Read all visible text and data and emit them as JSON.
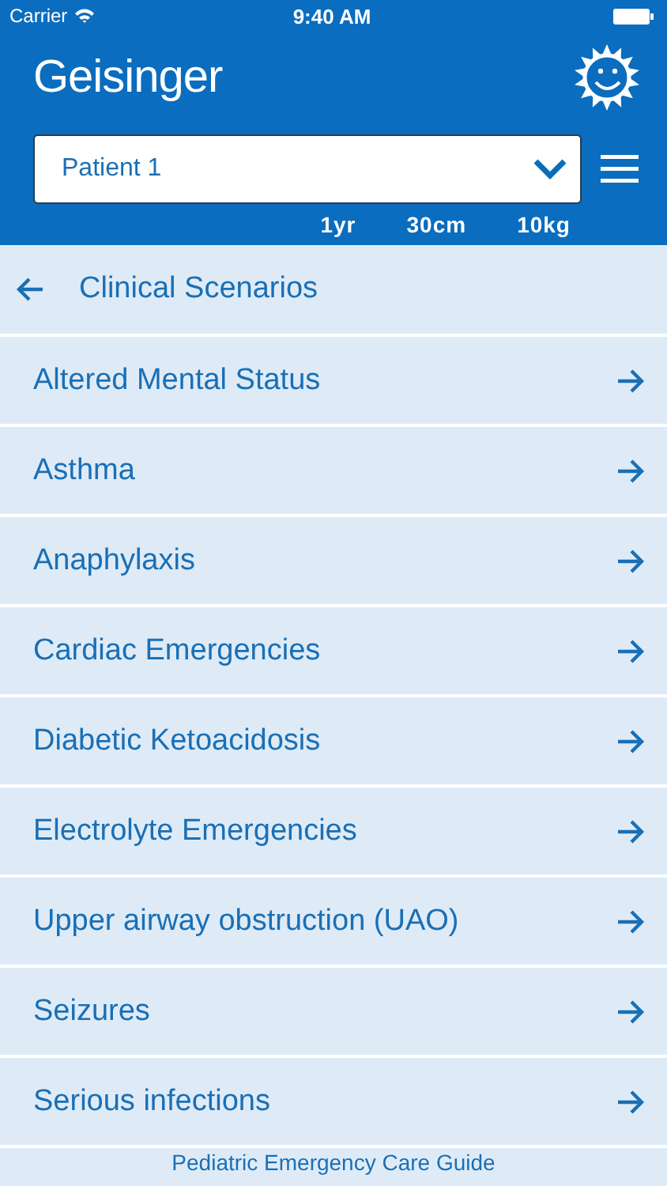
{
  "status_bar": {
    "carrier": "Carrier",
    "time": "9:40 AM"
  },
  "header": {
    "title": "Geisinger",
    "patient_select": {
      "value": "Patient 1"
    },
    "metrics": [
      "1yr",
      "30cm",
      "10kg"
    ]
  },
  "section": {
    "title": "Clinical Scenarios"
  },
  "items": [
    {
      "label": "Altered Mental Status"
    },
    {
      "label": "Asthma"
    },
    {
      "label": "Anaphylaxis"
    },
    {
      "label": "Cardiac Emergencies"
    },
    {
      "label": "Diabetic Ketoacidosis"
    },
    {
      "label": "Electrolyte Emergencies"
    },
    {
      "label": "Upper airway obstruction (UAO)"
    },
    {
      "label": "Seizures"
    },
    {
      "label": "Serious infections"
    }
  ],
  "footer": "Pediatric Emergency Care Guide"
}
